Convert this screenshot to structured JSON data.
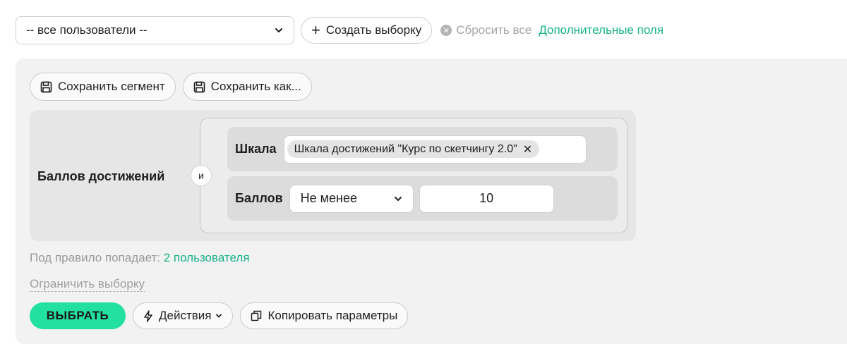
{
  "toolbar": {
    "user_filter_value": "-- все пользователи --",
    "create_selection_label": "Создать выборку",
    "reset_all_label": "Сбросить все",
    "extra_fields_label": "Дополнительные поля"
  },
  "panel": {
    "save_segment_label": "Сохранить сегмент",
    "save_as_label": "Сохранить как...",
    "rule": {
      "label": "Баллов достижений",
      "logic_operator": "и",
      "conditions": [
        {
          "key": "Шкала",
          "chip": "Шкала достижений \"Курс по скетчингу 2.0\""
        },
        {
          "key": "Баллов",
          "operator": "Не менее",
          "value": "10"
        }
      ]
    },
    "match_prefix": "Под правило попадает:",
    "match_count": "2 пользователя",
    "limit_selection_label": "Ограничить выборку",
    "select_button_label": "ВЫБРАТЬ",
    "actions_label": "Действия",
    "copy_params_label": "Копировать параметры"
  },
  "colors": {
    "accent": "#17b387",
    "primary_button": "#22e0a0",
    "panel_bg": "#f2f2f2"
  }
}
